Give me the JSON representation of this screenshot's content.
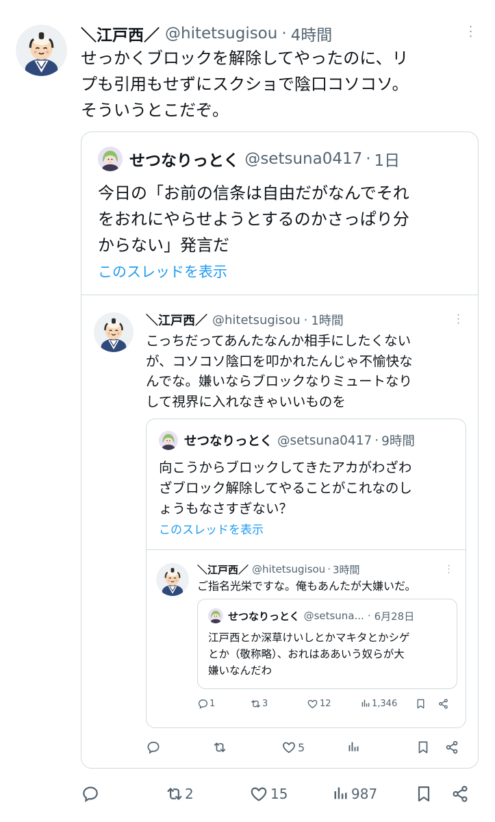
{
  "main": {
    "author_name": "＼江戸西／",
    "author_handle": "@hitetsugisou",
    "sep": "·",
    "time": "4時間",
    "text_lines": [
      "せっかくブロックを解除してやったのに、リ",
      "プも引用もせずにスクショで陰口コソコソ。",
      "そういうとこだぞ。"
    ],
    "actions": {
      "reply": "",
      "retweet": "2",
      "like": "15",
      "views": "987"
    }
  },
  "quote1": {
    "author_name": "せつなりっとく",
    "author_handle": "@setsuna0417",
    "time": "1日",
    "text_lines": [
      "今日の「お前の信条は自由だがなんでそれ",
      "をおれにやらせようとするのかさっぱり分",
      "からない」発言だ"
    ],
    "thread_link": "このスレッドを表示"
  },
  "reply1": {
    "author_name": "＼江戸西／",
    "author_handle": "@hitetsugisou",
    "time": "1時間",
    "text_lines": [
      "こっちだってあんたなんか相手にしたくない",
      "が、コソコソ陰口を叩かれたんじゃ不愉快な",
      "んでな。嫌いならブロックなりミュートなり",
      "して視界に入れなきゃいいものを"
    ],
    "actions": {
      "reply": "",
      "retweet": "",
      "like": "5",
      "views": ""
    }
  },
  "quote2": {
    "author_name": "せつなりっとく",
    "author_handle": "@setsuna0417",
    "time": "9時間",
    "text_lines": [
      "向こうからブロックしてきたアカがわざわ",
      "ざブロック解除してやることがこれなのし",
      "ょうもなさすぎない？"
    ],
    "thread_link": "このスレッドを表示"
  },
  "reply2": {
    "author_name": "＼江戸西／",
    "author_handle": "@hitetsugisou",
    "time": "3時間",
    "text": "ご指名光栄ですな。俺もあんたが大嫌いだ。",
    "actions": {
      "reply": "1",
      "retweet": "3",
      "like": "12",
      "views": "1,346"
    }
  },
  "quote3": {
    "author_name": "せつなりっとく",
    "author_handle": "@setsuna...",
    "time": "6月28日",
    "text_lines": [
      "江戸西とか深草けいしとかマキタとかシゲ",
      "とか（敬称略）、おれはああいう奴らが大",
      "嫌いなんだわ"
    ]
  },
  "colors": {
    "accent": "#1d9bf0",
    "muted": "#536471",
    "border": "#cfd9de",
    "text": "#0f1419"
  },
  "icons": [
    "reply-icon",
    "retweet-icon",
    "like-icon",
    "views-icon",
    "bookmark-icon",
    "share-icon",
    "more-dots-icon"
  ]
}
